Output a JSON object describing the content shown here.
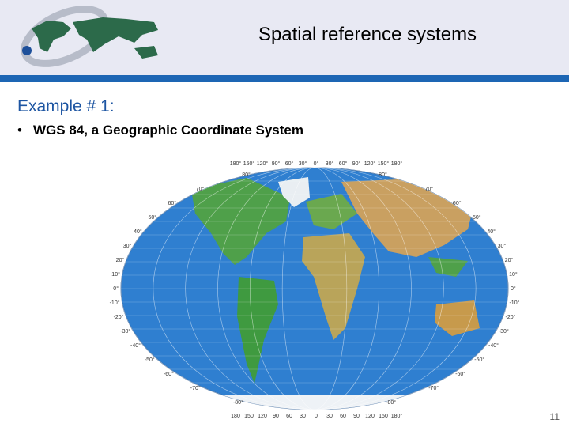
{
  "slide": {
    "title": "Spatial reference systems",
    "subtitle": "Example # 1:",
    "bullet": "WGS 84, a Geographic Coordinate System",
    "page_number": "11"
  },
  "map": {
    "top_longitudes": [
      "180°",
      "150°",
      "120°",
      "90°",
      "60°",
      "30°",
      "0°",
      "30°",
      "60°",
      "90°",
      "120°",
      "150°",
      "180°"
    ],
    "bottom_longitudes": [
      "180",
      "150",
      "120",
      "90",
      "60",
      "30",
      "0",
      "30",
      "60",
      "90",
      "120",
      "150",
      "180°"
    ],
    "left_latitudes": [
      "80°",
      "70°",
      "60°",
      "50°",
      "40°",
      "30°",
      "20°",
      "10°",
      "0°",
      "-10°",
      "-20°",
      "-30°",
      "-40°",
      "-50°",
      "-60°",
      "-70°",
      "-80°"
    ],
    "right_latitudes": [
      "80°",
      "70°",
      "60°",
      "50°",
      "40°",
      "30°",
      "20°",
      "10°",
      "0°",
      "-10°",
      "-20°",
      "-30°",
      "-40°",
      "-50°",
      "-60°",
      "-70°",
      "-80°"
    ]
  },
  "colors": {
    "header_bg": "#e8e9f3",
    "header_bar": "#1d66b4",
    "subtitle": "#1d55a2",
    "ocean": "#2f7fd0",
    "land": "#4fa04a"
  }
}
